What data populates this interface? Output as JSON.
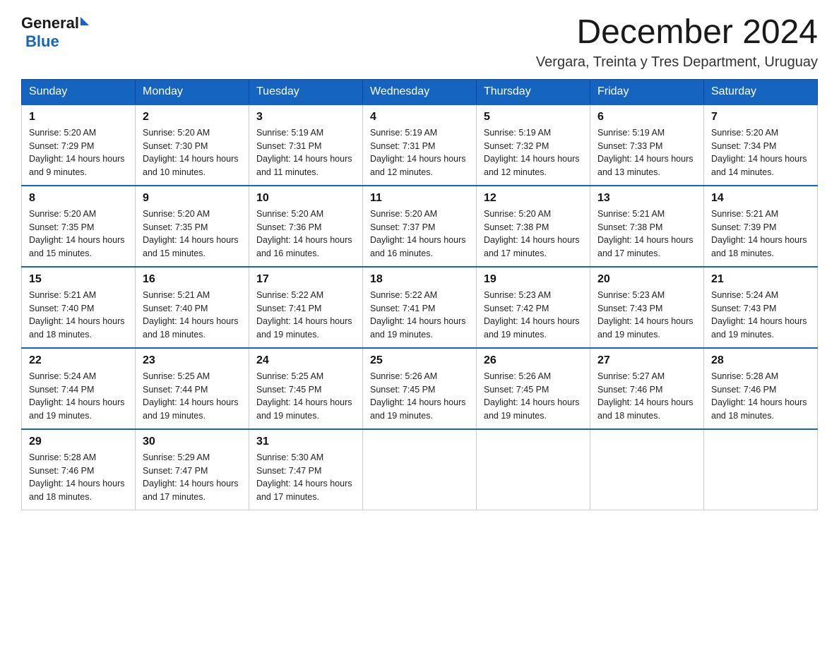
{
  "logo": {
    "general": "General",
    "blue": "Blue"
  },
  "header": {
    "month_year": "December 2024",
    "location": "Vergara, Treinta y Tres Department, Uruguay"
  },
  "days_of_week": [
    "Sunday",
    "Monday",
    "Tuesday",
    "Wednesday",
    "Thursday",
    "Friday",
    "Saturday"
  ],
  "weeks": [
    [
      {
        "day": "1",
        "sunrise": "5:20 AM",
        "sunset": "7:29 PM",
        "daylight": "14 hours and 9 minutes."
      },
      {
        "day": "2",
        "sunrise": "5:20 AM",
        "sunset": "7:30 PM",
        "daylight": "14 hours and 10 minutes."
      },
      {
        "day": "3",
        "sunrise": "5:19 AM",
        "sunset": "7:31 PM",
        "daylight": "14 hours and 11 minutes."
      },
      {
        "day": "4",
        "sunrise": "5:19 AM",
        "sunset": "7:31 PM",
        "daylight": "14 hours and 12 minutes."
      },
      {
        "day": "5",
        "sunrise": "5:19 AM",
        "sunset": "7:32 PM",
        "daylight": "14 hours and 12 minutes."
      },
      {
        "day": "6",
        "sunrise": "5:19 AM",
        "sunset": "7:33 PM",
        "daylight": "14 hours and 13 minutes."
      },
      {
        "day": "7",
        "sunrise": "5:20 AM",
        "sunset": "7:34 PM",
        "daylight": "14 hours and 14 minutes."
      }
    ],
    [
      {
        "day": "8",
        "sunrise": "5:20 AM",
        "sunset": "7:35 PM",
        "daylight": "14 hours and 15 minutes."
      },
      {
        "day": "9",
        "sunrise": "5:20 AM",
        "sunset": "7:35 PM",
        "daylight": "14 hours and 15 minutes."
      },
      {
        "day": "10",
        "sunrise": "5:20 AM",
        "sunset": "7:36 PM",
        "daylight": "14 hours and 16 minutes."
      },
      {
        "day": "11",
        "sunrise": "5:20 AM",
        "sunset": "7:37 PM",
        "daylight": "14 hours and 16 minutes."
      },
      {
        "day": "12",
        "sunrise": "5:20 AM",
        "sunset": "7:38 PM",
        "daylight": "14 hours and 17 minutes."
      },
      {
        "day": "13",
        "sunrise": "5:21 AM",
        "sunset": "7:38 PM",
        "daylight": "14 hours and 17 minutes."
      },
      {
        "day": "14",
        "sunrise": "5:21 AM",
        "sunset": "7:39 PM",
        "daylight": "14 hours and 18 minutes."
      }
    ],
    [
      {
        "day": "15",
        "sunrise": "5:21 AM",
        "sunset": "7:40 PM",
        "daylight": "14 hours and 18 minutes."
      },
      {
        "day": "16",
        "sunrise": "5:21 AM",
        "sunset": "7:40 PM",
        "daylight": "14 hours and 18 minutes."
      },
      {
        "day": "17",
        "sunrise": "5:22 AM",
        "sunset": "7:41 PM",
        "daylight": "14 hours and 19 minutes."
      },
      {
        "day": "18",
        "sunrise": "5:22 AM",
        "sunset": "7:41 PM",
        "daylight": "14 hours and 19 minutes."
      },
      {
        "day": "19",
        "sunrise": "5:23 AM",
        "sunset": "7:42 PM",
        "daylight": "14 hours and 19 minutes."
      },
      {
        "day": "20",
        "sunrise": "5:23 AM",
        "sunset": "7:43 PM",
        "daylight": "14 hours and 19 minutes."
      },
      {
        "day": "21",
        "sunrise": "5:24 AM",
        "sunset": "7:43 PM",
        "daylight": "14 hours and 19 minutes."
      }
    ],
    [
      {
        "day": "22",
        "sunrise": "5:24 AM",
        "sunset": "7:44 PM",
        "daylight": "14 hours and 19 minutes."
      },
      {
        "day": "23",
        "sunrise": "5:25 AM",
        "sunset": "7:44 PM",
        "daylight": "14 hours and 19 minutes."
      },
      {
        "day": "24",
        "sunrise": "5:25 AM",
        "sunset": "7:45 PM",
        "daylight": "14 hours and 19 minutes."
      },
      {
        "day": "25",
        "sunrise": "5:26 AM",
        "sunset": "7:45 PM",
        "daylight": "14 hours and 19 minutes."
      },
      {
        "day": "26",
        "sunrise": "5:26 AM",
        "sunset": "7:45 PM",
        "daylight": "14 hours and 19 minutes."
      },
      {
        "day": "27",
        "sunrise": "5:27 AM",
        "sunset": "7:46 PM",
        "daylight": "14 hours and 18 minutes."
      },
      {
        "day": "28",
        "sunrise": "5:28 AM",
        "sunset": "7:46 PM",
        "daylight": "14 hours and 18 minutes."
      }
    ],
    [
      {
        "day": "29",
        "sunrise": "5:28 AM",
        "sunset": "7:46 PM",
        "daylight": "14 hours and 18 minutes."
      },
      {
        "day": "30",
        "sunrise": "5:29 AM",
        "sunset": "7:47 PM",
        "daylight": "14 hours and 17 minutes."
      },
      {
        "day": "31",
        "sunrise": "5:30 AM",
        "sunset": "7:47 PM",
        "daylight": "14 hours and 17 minutes."
      },
      null,
      null,
      null,
      null
    ]
  ],
  "labels": {
    "sunrise": "Sunrise:",
    "sunset": "Sunset:",
    "daylight": "Daylight:"
  }
}
